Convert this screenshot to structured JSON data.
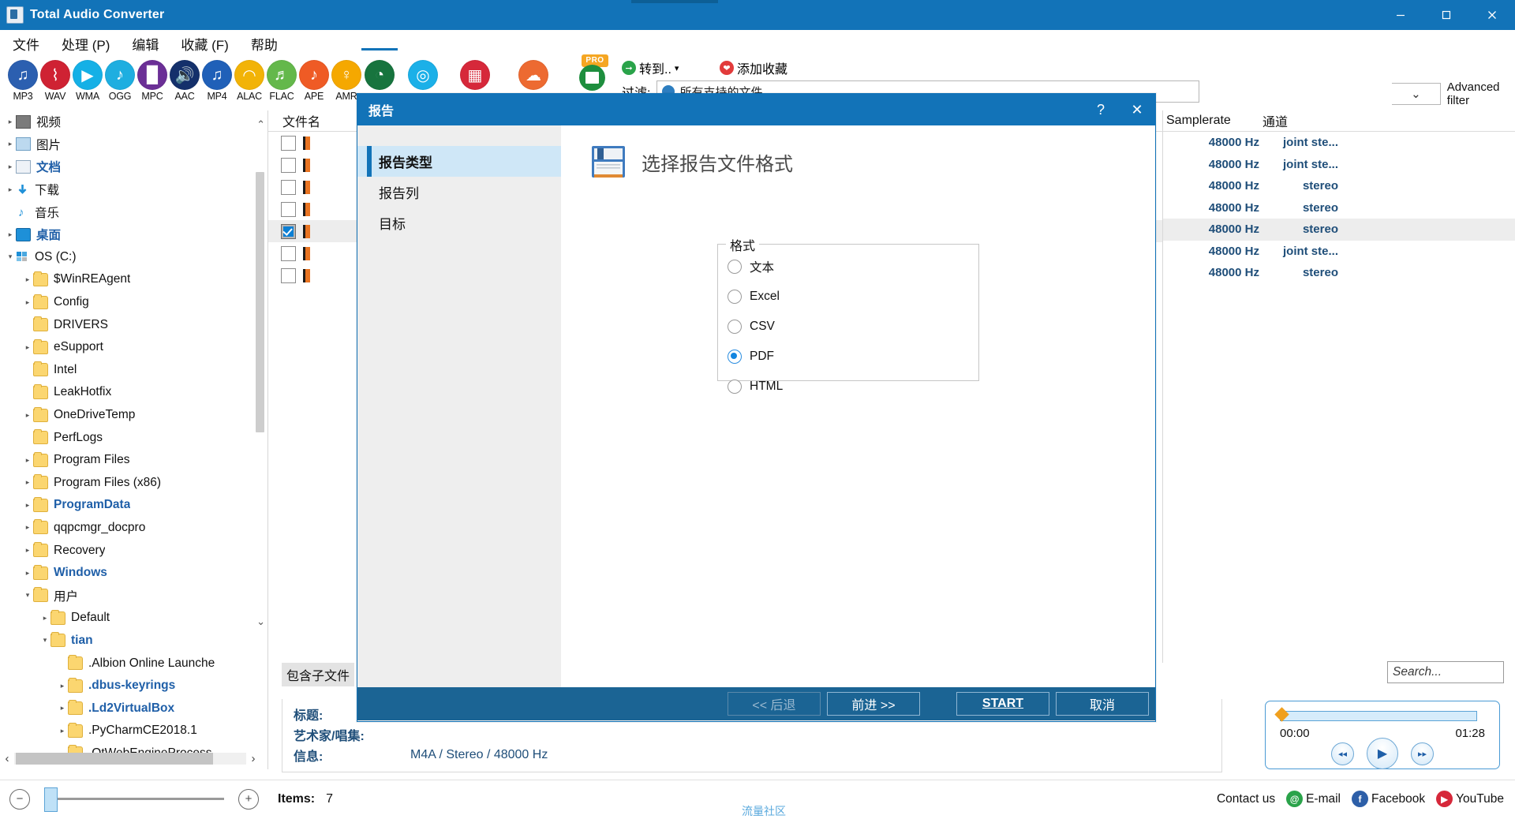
{
  "window": {
    "title": "Total Audio Converter",
    "icon": "app-icon",
    "minimize": "─",
    "maximize": "❐",
    "close": "✕"
  },
  "menubar": [
    {
      "label": "文件",
      "name": "menu-file"
    },
    {
      "label": "处理 (P)",
      "name": "menu-process"
    },
    {
      "label": "编辑",
      "name": "menu-edit"
    },
    {
      "label": "收藏 (F)",
      "name": "menu-favorites"
    },
    {
      "label": "帮助",
      "name": "menu-help"
    }
  ],
  "format_toolbar": [
    {
      "label": "MP3",
      "color": "#2b5fb0",
      "glyph": "♫",
      "name": "format-mp3"
    },
    {
      "label": "WAV",
      "color": "#cf2233",
      "glyph": "⌇",
      "name": "format-wav"
    },
    {
      "label": "WMA",
      "color": "#15b0e6",
      "glyph": "▶",
      "name": "format-wma"
    },
    {
      "label": "OGG",
      "color": "#1eaee0",
      "glyph": "♪",
      "name": "format-ogg"
    },
    {
      "label": "MPC",
      "color": "#6b2f96",
      "glyph": "█",
      "name": "format-mpc"
    },
    {
      "label": "AAC",
      "color": "#14306b",
      "glyph": "🔊",
      "name": "format-aac"
    },
    {
      "label": "MP4",
      "color": "#2060b8",
      "glyph": "♫",
      "name": "format-mp4"
    },
    {
      "label": "ALAC",
      "color": "#f2b307",
      "glyph": "◠",
      "name": "format-alac"
    },
    {
      "label": "FLAC",
      "color": "#64b84b",
      "glyph": "♬",
      "name": "format-flac"
    },
    {
      "label": "APE",
      "color": "#ef5b25",
      "glyph": "♪",
      "name": "format-ape"
    },
    {
      "label": "AMR",
      "color": "#f5a800",
      "glyph": "♀",
      "name": "format-amr"
    },
    {
      "label": "",
      "color": "#17743e",
      "glyph": "◔",
      "name": "format-ogv"
    },
    {
      "label": "",
      "color": "#1bb0e8",
      "glyph": "◎",
      "name": "format-cd"
    },
    {
      "label": "",
      "color": "#d6283a",
      "glyph": "▦",
      "name": "format-youtube"
    },
    {
      "label": "",
      "color": "#ed6a31",
      "glyph": "☁",
      "name": "format-cloud"
    }
  ],
  "right_toolbar": {
    "pro_badge": "PRO",
    "goto_label": "转到..",
    "goto_caret": "▾",
    "favorites_label": "添加收藏",
    "filter_label": "过滤:",
    "filter_value": "所有支持的文件",
    "advanced_filter": "Advanced filter",
    "dropdown_caret": "⌄"
  },
  "tree": {
    "scroll_up": "⌃",
    "scroll_down": "⌄",
    "items": [
      {
        "label": "视频",
        "indent": 0,
        "arrow": "▸",
        "icon": "video-icon",
        "style": "normal"
      },
      {
        "label": "图片",
        "indent": 0,
        "arrow": "▸",
        "icon": "picture-icon",
        "style": "normal"
      },
      {
        "label": "文档",
        "indent": 0,
        "arrow": "▸",
        "icon": "document-icon",
        "style": "bluebold"
      },
      {
        "label": "下载",
        "indent": 0,
        "arrow": "▸",
        "icon": "download-icon",
        "style": "normal"
      },
      {
        "label": "音乐",
        "indent": 0,
        "arrow": "",
        "icon": "music-icon",
        "style": "normal"
      },
      {
        "label": "桌面",
        "indent": 0,
        "arrow": "▸",
        "icon": "desktop-icon",
        "style": "bluebold"
      },
      {
        "label": "OS (C:)",
        "indent": 0,
        "arrow": "▾",
        "icon": "drive-icon",
        "style": "normal"
      },
      {
        "label": "$WinREAgent",
        "indent": 1,
        "arrow": "▸",
        "icon": "folder-icon",
        "style": "normal"
      },
      {
        "label": "Config",
        "indent": 1,
        "arrow": "▸",
        "icon": "folder-icon",
        "style": "normal"
      },
      {
        "label": "DRIVERS",
        "indent": 1,
        "arrow": "",
        "icon": "folder-icon",
        "style": "normal"
      },
      {
        "label": "eSupport",
        "indent": 1,
        "arrow": "▸",
        "icon": "folder-icon",
        "style": "normal"
      },
      {
        "label": "Intel",
        "indent": 1,
        "arrow": "",
        "icon": "folder-icon",
        "style": "normal"
      },
      {
        "label": "LeakHotfix",
        "indent": 1,
        "arrow": "",
        "icon": "folder-icon",
        "style": "normal"
      },
      {
        "label": "OneDriveTemp",
        "indent": 1,
        "arrow": "▸",
        "icon": "folder-icon",
        "style": "normal"
      },
      {
        "label": "PerfLogs",
        "indent": 1,
        "arrow": "",
        "icon": "folder-icon",
        "style": "normal"
      },
      {
        "label": "Program Files",
        "indent": 1,
        "arrow": "▸",
        "icon": "folder-icon",
        "style": "normal"
      },
      {
        "label": "Program Files (x86)",
        "indent": 1,
        "arrow": "▸",
        "icon": "folder-icon",
        "style": "normal"
      },
      {
        "label": "ProgramData",
        "indent": 1,
        "arrow": "▸",
        "icon": "folder-icon",
        "style": "bluebold"
      },
      {
        "label": "qqpcmgr_docpro",
        "indent": 1,
        "arrow": "▸",
        "icon": "folder-icon",
        "style": "normal"
      },
      {
        "label": "Recovery",
        "indent": 1,
        "arrow": "▸",
        "icon": "folder-icon",
        "style": "normal"
      },
      {
        "label": "Windows",
        "indent": 1,
        "arrow": "▸",
        "icon": "folder-icon",
        "style": "bluebold"
      },
      {
        "label": "用户",
        "indent": 1,
        "arrow": "▾",
        "icon": "folder-icon",
        "style": "normal"
      },
      {
        "label": "Default",
        "indent": 2,
        "arrow": "▸",
        "icon": "folder-icon",
        "style": "normal"
      },
      {
        "label": "tian",
        "indent": 2,
        "arrow": "▾",
        "icon": "folder-icon",
        "style": "bluebold"
      },
      {
        "label": ".Albion Online Launche",
        "indent": 3,
        "arrow": "",
        "icon": "folder-icon",
        "style": "normal"
      },
      {
        "label": ".dbus-keyrings",
        "indent": 3,
        "arrow": "▸",
        "icon": "folder-icon",
        "style": "bluebold"
      },
      {
        "label": ".Ld2VirtualBox",
        "indent": 3,
        "arrow": "▸",
        "icon": "folder-icon",
        "style": "bluebold"
      },
      {
        "label": ".PyCharmCE2018.1",
        "indent": 3,
        "arrow": "▸",
        "icon": "folder-icon",
        "style": "normal"
      },
      {
        "label": ".QtWebEngineProcess",
        "indent": 3,
        "arrow": "",
        "icon": "folder-icon",
        "style": "normal"
      }
    ]
  },
  "file_list": {
    "header": "文件名",
    "rows": [
      {
        "checked": false,
        "selected": false
      },
      {
        "checked": false,
        "selected": false
      },
      {
        "checked": false,
        "selected": false
      },
      {
        "checked": false,
        "selected": false
      },
      {
        "checked": true,
        "selected": true
      },
      {
        "checked": false,
        "selected": false
      },
      {
        "checked": false,
        "selected": false
      }
    ]
  },
  "meta_table": {
    "columns": [
      "Samplerate",
      "通道"
    ],
    "rows": [
      {
        "samplerate": "48000 Hz",
        "channels": "joint ste...",
        "selected": false
      },
      {
        "samplerate": "48000 Hz",
        "channels": "joint ste...",
        "selected": false
      },
      {
        "samplerate": "48000 Hz",
        "channels": "stereo",
        "selected": false
      },
      {
        "samplerate": "48000 Hz",
        "channels": "stereo",
        "selected": false
      },
      {
        "samplerate": "48000 Hz",
        "channels": "stereo",
        "selected": true
      },
      {
        "samplerate": "48000 Hz",
        "channels": "joint ste...",
        "selected": false
      },
      {
        "samplerate": "48000 Hz",
        "channels": "stereo",
        "selected": false
      }
    ]
  },
  "subfiles_label": "包含子文件",
  "info_panel": {
    "rows": [
      {
        "label": "标题:",
        "value": ""
      },
      {
        "label": "艺术家/唱集:",
        "value": ""
      },
      {
        "label": "信息:",
        "value": "M4A / Stereo / 48000 Hz"
      }
    ]
  },
  "search": {
    "placeholder": "Search...",
    "value": ""
  },
  "player": {
    "current_time": "00:00",
    "total_time": "01:28",
    "prev_icon": "◂◂",
    "play_icon": "▶",
    "next_icon": "▸▸",
    "progress_percent": 0
  },
  "status_bar": {
    "zoom_out": "−",
    "zoom_in": "+",
    "items_label": "Items:",
    "items_value": "7",
    "contact_label": "Contact us",
    "links": [
      {
        "label": "E-mail",
        "glyph": "@",
        "color": "#2aa34a",
        "name": "email-icon"
      },
      {
        "label": "Facebook",
        "glyph": "f",
        "color": "#2d5fa8",
        "name": "facebook-icon"
      },
      {
        "label": "YouTube",
        "glyph": "▶",
        "color": "#d6283a",
        "name": "youtube-icon"
      }
    ]
  },
  "hscroll": {
    "left": "‹",
    "right": "›"
  },
  "watermark": "流量社区",
  "dialog": {
    "title": "报告",
    "help_btn": "?",
    "close_btn": "✕",
    "nav": [
      {
        "label": "报告类型",
        "active": true,
        "name": "dialog-nav-report-type"
      },
      {
        "label": "报告列",
        "active": false,
        "name": "dialog-nav-report-columns"
      },
      {
        "label": "目标",
        "active": false,
        "name": "dialog-nav-target"
      }
    ],
    "heading": "选择报告文件格式",
    "group_label": "格式",
    "options": [
      {
        "label": "文本",
        "selected": false,
        "name": "radio-text"
      },
      {
        "label": "Excel",
        "selected": false,
        "name": "radio-excel"
      },
      {
        "label": "CSV",
        "selected": false,
        "name": "radio-csv"
      },
      {
        "label": "PDF",
        "selected": true,
        "name": "radio-pdf"
      },
      {
        "label": "HTML",
        "selected": false,
        "name": "radio-html"
      }
    ],
    "buttons": [
      {
        "label": "<< 后退",
        "disabled": true,
        "style": "normal",
        "name": "dialog-back-button"
      },
      {
        "label": "前进 >>",
        "disabled": false,
        "style": "normal",
        "name": "dialog-next-button"
      },
      {
        "label": "START",
        "disabled": false,
        "style": "start",
        "name": "dialog-start-button"
      },
      {
        "label": "取消",
        "disabled": false,
        "style": "normal",
        "name": "dialog-cancel-button"
      }
    ]
  },
  "colors": {
    "accent": "#1273b8",
    "dialog_footer": "#1b6494",
    "nav_active": "#cfe7f7",
    "link_blue": "#1f4e79"
  }
}
